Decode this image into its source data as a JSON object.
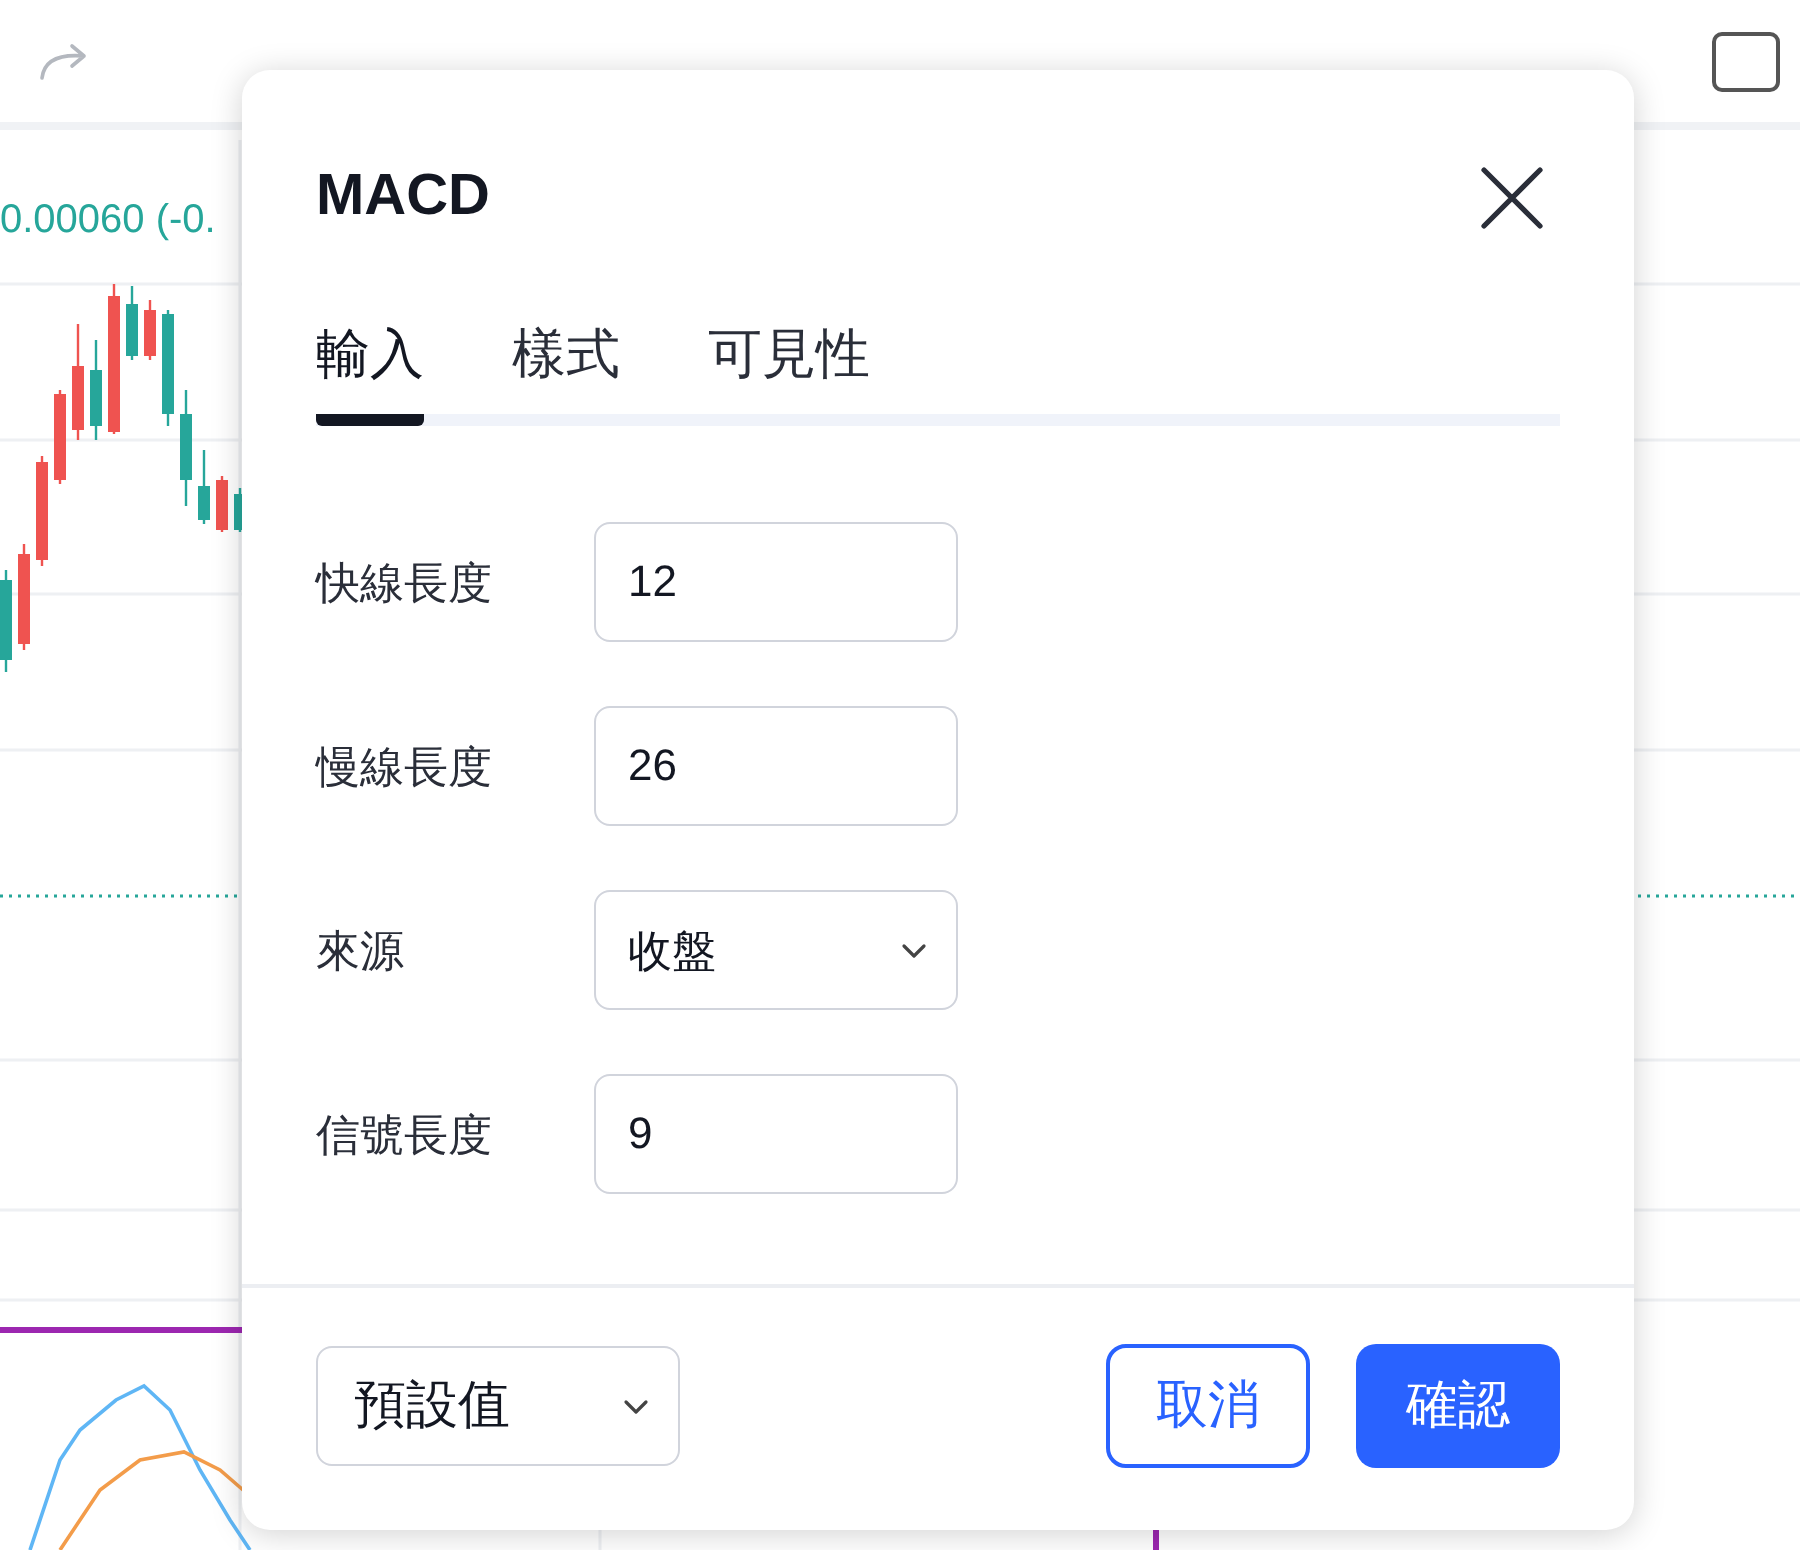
{
  "chart": {
    "price_change": "0.00060 (-0."
  },
  "dialog": {
    "title": "MACD",
    "tabs": [
      {
        "label": "輸入",
        "selected": true
      },
      {
        "label": "樣式",
        "selected": false
      },
      {
        "label": "可見性",
        "selected": false
      }
    ],
    "fields": [
      {
        "label": "快線長度",
        "kind": "number",
        "value": "12"
      },
      {
        "label": "慢線長度",
        "kind": "number",
        "value": "26"
      },
      {
        "label": "來源",
        "kind": "select",
        "value": "收盤"
      },
      {
        "label": "信號長度",
        "kind": "number",
        "value": "9"
      }
    ],
    "footer": {
      "preset": "預設值",
      "cancel": "取消",
      "confirm": "確認"
    }
  }
}
